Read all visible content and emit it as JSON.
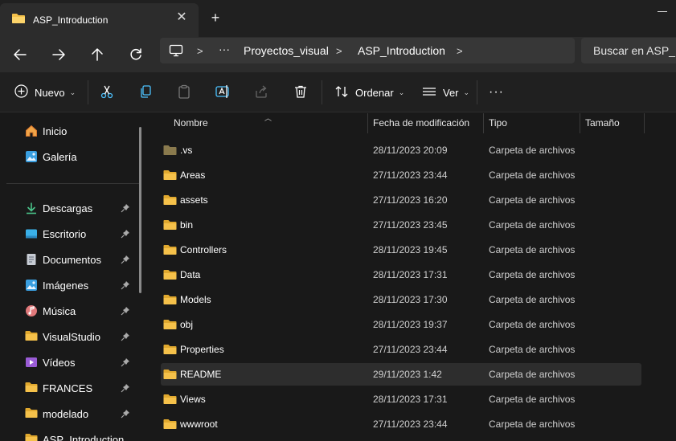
{
  "tab": {
    "title": "ASP_Introduction",
    "close_glyph": "✕",
    "add_glyph": "+"
  },
  "address": {
    "ellipsis": "···",
    "crumbs": [
      "Proyectos_visual",
      "ASP_Introduction"
    ],
    "separator": ">"
  },
  "search": {
    "placeholder": "Buscar en ASP_Introduction"
  },
  "toolbar": {
    "new_label": "Nuevo",
    "sort_label": "Ordenar",
    "view_label": "Ver",
    "more_glyph": "···"
  },
  "sidebar": {
    "top_items": [
      {
        "label": "Inicio",
        "icon": "home-icon"
      },
      {
        "label": "Galería",
        "icon": "gallery-icon"
      }
    ],
    "pinned_items": [
      {
        "label": "Descargas",
        "icon": "download-icon"
      },
      {
        "label": "Escritorio",
        "icon": "desktop-icon"
      },
      {
        "label": "Documentos",
        "icon": "document-icon"
      },
      {
        "label": "Imágenes",
        "icon": "pictures-icon"
      },
      {
        "label": "Música",
        "icon": "music-icon"
      },
      {
        "label": "VisualStudio",
        "icon": "folder-icon"
      },
      {
        "label": "Vídeos",
        "icon": "videos-icon"
      },
      {
        "label": "FRANCES",
        "icon": "folder-icon"
      },
      {
        "label": "modelado",
        "icon": "folder-icon"
      },
      {
        "label": "ASP_Introduction",
        "icon": "folder-icon"
      }
    ]
  },
  "columns": {
    "name": "Nombre",
    "modified": "Fecha de modificación",
    "type": "Tipo",
    "size": "Tamaño"
  },
  "files": [
    {
      "name": ".vs",
      "date": "28/11/2023 20:09",
      "type": "Carpeta de archivos",
      "hidden": true
    },
    {
      "name": "Areas",
      "date": "27/11/2023 23:44",
      "type": "Carpeta de archivos"
    },
    {
      "name": "assets",
      "date": "27/11/2023 16:20",
      "type": "Carpeta de archivos"
    },
    {
      "name": "bin",
      "date": "27/11/2023 23:45",
      "type": "Carpeta de archivos"
    },
    {
      "name": "Controllers",
      "date": "28/11/2023 19:45",
      "type": "Carpeta de archivos"
    },
    {
      "name": "Data",
      "date": "28/11/2023 17:31",
      "type": "Carpeta de archivos"
    },
    {
      "name": "Models",
      "date": "28/11/2023 17:30",
      "type": "Carpeta de archivos"
    },
    {
      "name": "obj",
      "date": "28/11/2023 19:37",
      "type": "Carpeta de archivos"
    },
    {
      "name": "Properties",
      "date": "27/11/2023 23:44",
      "type": "Carpeta de archivos"
    },
    {
      "name": "README",
      "date": "29/11/2023 1:42",
      "type": "Carpeta de archivos",
      "highlighted": true
    },
    {
      "name": "Views",
      "date": "28/11/2023 17:31",
      "type": "Carpeta de archivos"
    },
    {
      "name": "wwwroot",
      "date": "27/11/2023 23:44",
      "type": "Carpeta de archivos"
    }
  ],
  "colors": {
    "folder": "#f5c14a",
    "folder_dark": "#e0a82e",
    "hidden_folder": "#8a7a4e",
    "accent": "#4cc2ff"
  }
}
